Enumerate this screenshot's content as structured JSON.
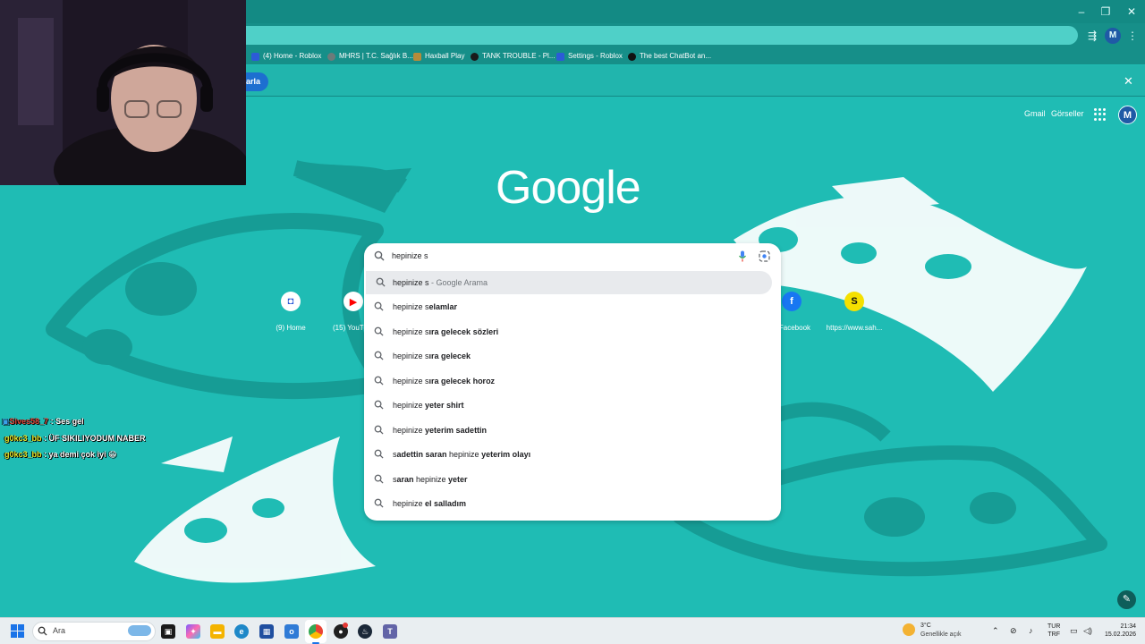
{
  "browser": {
    "window_controls": {
      "minimize": "–",
      "restore": "❐",
      "close": "✕"
    },
    "bookmarks": [
      {
        "label": "(4) Home - Roblox",
        "color": "#2c5bd7"
      },
      {
        "label": "MHRS | T.C. Sağlık B...",
        "color": "#6c7b7a"
      },
      {
        "label": "Haxball Play",
        "color": "#b58b3a"
      },
      {
        "label": "TANK TROUBLE - Pl...",
        "color": "#1a1a1a"
      },
      {
        "label": "Settings - Roblox",
        "color": "#2c5bd7"
      },
      {
        "label": "The best ChatBot an...",
        "color": "#111111"
      }
    ],
    "infobar": {
      "button_label": "arla",
      "close": "✕"
    },
    "profile_initial": "M"
  },
  "google": {
    "links": {
      "gmail": "Gmail",
      "images": "Görseller"
    },
    "avatar_initial": "M",
    "logo": "Google",
    "shortcuts": [
      {
        "label": "(9) Home",
        "icon": "roblox-icon",
        "bg": "#ffffff",
        "fg": "#2c5bd7",
        "glyph": "◘"
      },
      {
        "label": "(15) YouTu",
        "icon": "youtube-icon",
        "bg": "#ffffff",
        "fg": "#ff0000",
        "glyph": "▶"
      },
      {
        "label": ") Facebook",
        "icon": "facebook-icon",
        "bg": "#1877f2",
        "fg": "#ffffff",
        "glyph": "f"
      },
      {
        "label": "https://www.sah...",
        "icon": "s-icon",
        "bg": "#f5e000",
        "fg": "#111111",
        "glyph": "S"
      }
    ]
  },
  "search": {
    "query": "hepinize s",
    "suggestions": [
      {
        "prefix": "hepinize s",
        "bold": "",
        "suffix": " - Google Arama"
      },
      {
        "prefix": "hepinize s",
        "bold": "elamlar",
        "suffix": ""
      },
      {
        "prefix": "hepinize s",
        "bold": "ıra gelecek sözleri",
        "suffix": ""
      },
      {
        "prefix": "hepinize s",
        "bold": "ıra gelecek",
        "suffix": ""
      },
      {
        "prefix": "hepinize s",
        "bold": "ıra gelecek horoz",
        "suffix": ""
      },
      {
        "prefix": "hepinize ",
        "bold": "yeter shirt",
        "suffix": ""
      },
      {
        "prefix": "hepinize ",
        "bold": "yeterim sadettin",
        "suffix": ""
      },
      {
        "prefix": "s",
        "bold": "adettin saran ",
        "mid": "hepinize",
        "tail": " yeterim olayı"
      },
      {
        "prefix": "s",
        "bold": "aran ",
        "mid": "hepinize",
        "tail": " yeter"
      },
      {
        "prefix": "hepinize ",
        "bold": "el salladım",
        "suffix": ""
      }
    ]
  },
  "chat": [
    {
      "user": "Sives58_7",
      "sep": " : ",
      "msg": "Ses gel",
      "color": "#e0463a"
    },
    {
      "user": "g0kc3_bb",
      "sep": " : ",
      "msg": "ÜF SIKILIYODUM NABER",
      "color": "#e8e62a"
    },
    {
      "user": "g0kc3_bb",
      "sep": " : ",
      "msg": "ya demi çok iyi 😁",
      "color": "#e8e62a"
    }
  ],
  "taskbar": {
    "search_placeholder": "Ara",
    "weather_temp": "3°C",
    "weather_desc": "Genellikle açık",
    "lang_line1": "TUR",
    "lang_line2": "TRF",
    "time": "21:34",
    "date": "15.02.2026"
  }
}
